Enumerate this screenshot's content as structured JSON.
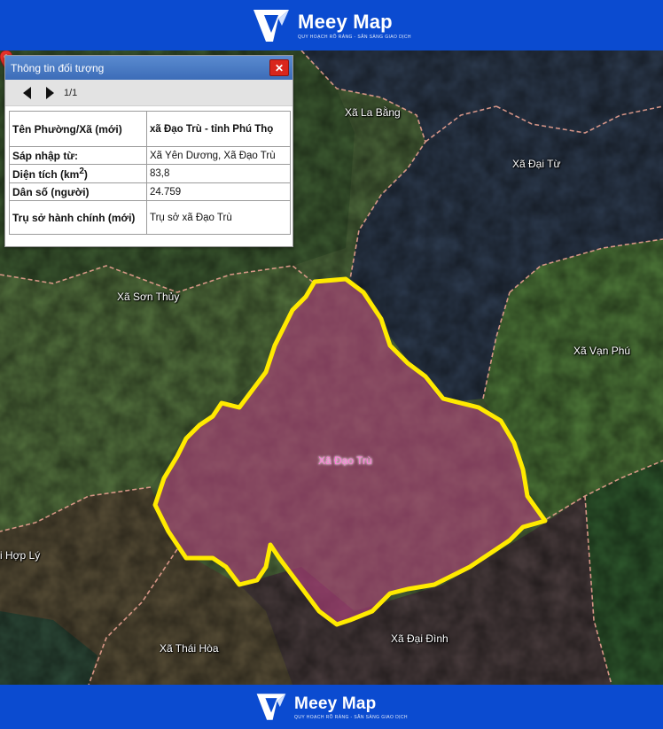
{
  "brand": {
    "name": "Meey Map",
    "tagline": "QUY HOẠCH RÕ RÀNG - SẴN SÀNG GIAO DỊCH"
  },
  "panel": {
    "title": "Thông tin đối tượng",
    "close_label": "✕",
    "pager_label": "1/1",
    "rows": [
      {
        "key": "Tên Phường/Xã (mới)",
        "value": "xã Đạo Trù - tỉnh Phú Thọ"
      },
      {
        "key": "Sáp nhập từ:",
        "value": "Xã Yên Dương, Xã Đạo Trù"
      },
      {
        "key": "Diện tích (km",
        "key_sup": "2",
        "key_tail": ")",
        "value": "83,8"
      },
      {
        "key": "Dân số (người)",
        "value": "24.759"
      },
      {
        "key": "Trụ sở hành chính (mới)",
        "value": "Trụ sở xã Đạo Trù"
      }
    ]
  },
  "map": {
    "places": {
      "la_bang": "Xã La Bằng",
      "dai_tu": "Xã Đại Từ",
      "son_thuy": "Xã Sơn Thủy",
      "van_phu": "Xã Vạn Phú",
      "dao_tru": "Xã Đạo Trù",
      "hop_ly": "i Hợp Lý",
      "thai_hoa": "Xã Thái Hòa",
      "dai_dinh": "Xã Đại Đình"
    },
    "highlight_color": "#ffea00",
    "fill_color": "#b5447f"
  }
}
